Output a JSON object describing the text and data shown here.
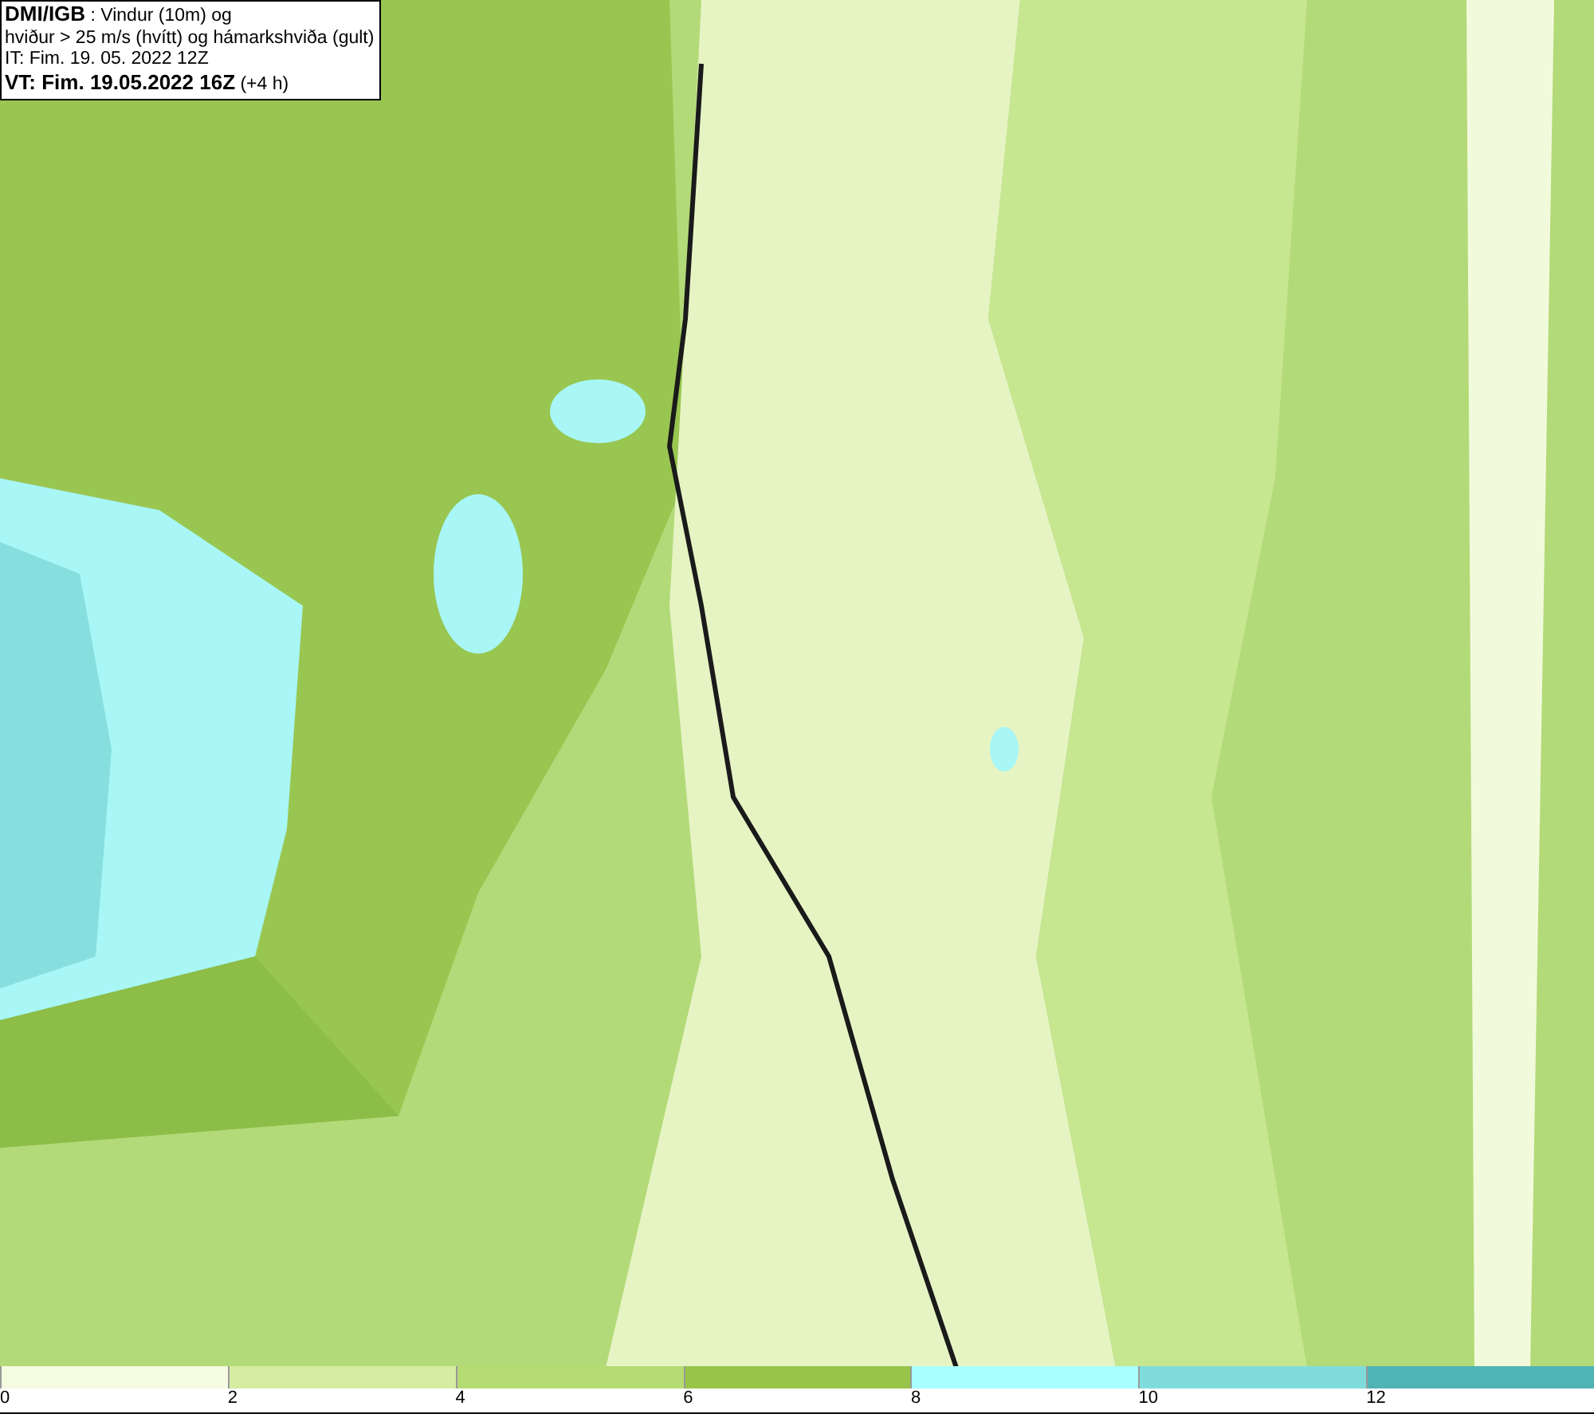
{
  "info_box": {
    "lines": [
      "**DMI/IGB** : Vindur (10m) og",
      "hviður > 25 m/s (hvítt) og hámarkshviða (gult)",
      "IT: Fim. 19. 05. 2022 12Z",
      "**VT: Fim. 19.05.2022 16Z** (+4 h)"
    ]
  },
  "legend": {
    "bins": [
      {
        "color": "#f4fbe0",
        "tick": "0"
      },
      {
        "color": "#d5eda0",
        "tick": "2"
      },
      {
        "color": "#b5dc72",
        "tick": "4"
      },
      {
        "color": "#98c44a",
        "tick": "6"
      },
      {
        "color": "#aaffff",
        "tick": "8"
      },
      {
        "color": "#80dcdc",
        "tick": "10"
      },
      {
        "color": "#50b4b4",
        "tick": "12"
      }
    ]
  }
}
